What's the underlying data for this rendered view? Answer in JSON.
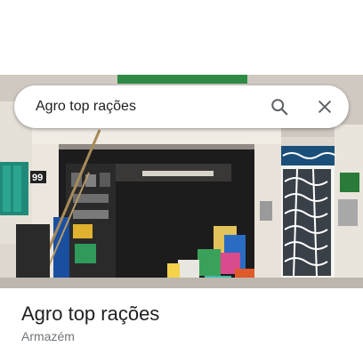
{
  "search": {
    "query": "Agro top rações",
    "search_icon": "search-icon",
    "close_icon": "close-icon"
  },
  "photo": {
    "house_number": "99",
    "icons": {
      "storefront": "storefront-photo"
    }
  },
  "place": {
    "name": "Agro top rações",
    "category": "Armazém"
  },
  "colors": {
    "text_primary": "#202124",
    "text_secondary": "#70757a",
    "icon": "#5f6368"
  }
}
